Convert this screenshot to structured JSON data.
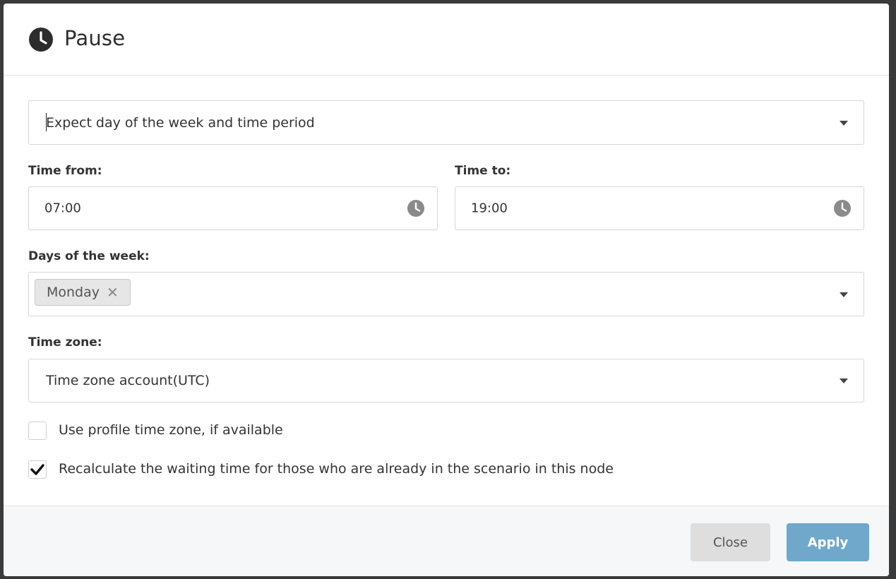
{
  "dialog": {
    "title": "Pause",
    "icon": "clock-icon"
  },
  "mode_select": {
    "value": "Expect day of the week and time period"
  },
  "time_from": {
    "label": "Time from:",
    "value": "07:00"
  },
  "time_to": {
    "label": "Time to:",
    "value": "19:00"
  },
  "days_of_week": {
    "label": "Days of the week:",
    "selected": [
      "Monday"
    ],
    "remove_glyph": "✕"
  },
  "time_zone": {
    "label": "Time zone:",
    "value": "Time zone account(UTC)"
  },
  "options": {
    "use_profile_tz": {
      "label": "Use profile time zone, if available",
      "checked": false
    },
    "recalculate": {
      "label": "Recalculate the waiting time for those who are already in the scenario in this node",
      "checked": true
    }
  },
  "footer": {
    "close_label": "Close",
    "apply_label": "Apply"
  },
  "colors": {
    "apply_button": "#6fa8cb",
    "close_button": "#dedede"
  }
}
